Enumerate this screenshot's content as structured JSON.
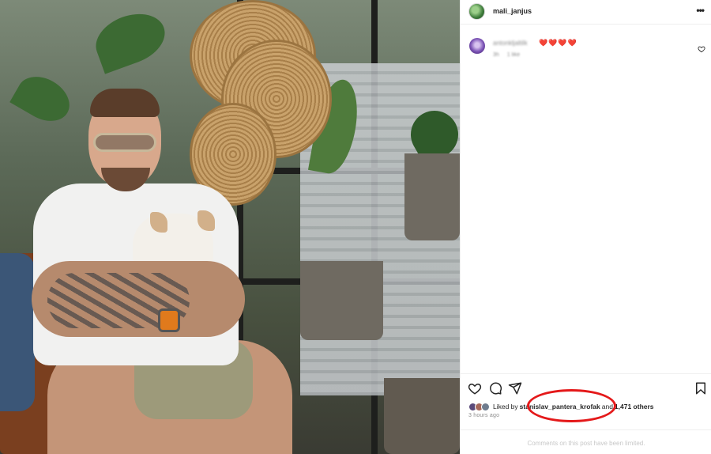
{
  "post": {
    "author": "mali_janjus",
    "more_icon": "more-horizontal-icon",
    "photo_alt": "Photo of a tattooed man in sunglasses holding a small white dog among plants and woven baskets"
  },
  "comment": {
    "username": "antonkljaltilk",
    "text_emoji": "❤️❤️❤️❤️",
    "time": "3h",
    "likes": "1 like"
  },
  "actions": {
    "like": "heart-icon",
    "comment": "comment-icon",
    "share": "share-icon",
    "save": "bookmark-icon"
  },
  "likes": {
    "prefix": "Liked by",
    "liker": "stanislav_pantera_krofak",
    "conjunction": "and",
    "others": "1,471 others"
  },
  "timestamp": "3 hours ago",
  "footer_note": "Comments on this post have been limited.",
  "colors": {
    "highlight_circle": "#e4191a",
    "heart_emoji": "#e0242b"
  }
}
